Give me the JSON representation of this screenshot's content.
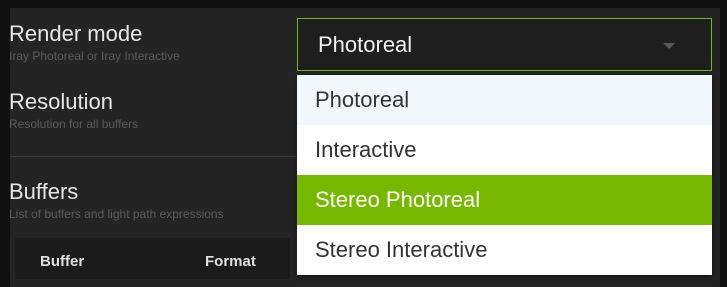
{
  "properties": [
    {
      "label": "Render mode",
      "description": "Iray Photoreal or Iray Interactive"
    },
    {
      "label": "Resolution",
      "description": "Resolution for all buffers"
    },
    {
      "label": "Buffers",
      "description": "List of buffers and light path expressions"
    }
  ],
  "buffers_table": {
    "columns": [
      "Buffer",
      "Format"
    ]
  },
  "render_mode_select": {
    "value": "Photoreal",
    "options": [
      "Photoreal",
      "Interactive",
      "Stereo Photoreal",
      "Stereo Interactive"
    ],
    "highlighted_option": "Stereo Photoreal"
  },
  "colors": {
    "accent": "#76b900",
    "panel": "#242424",
    "menu_bg": "#ffffff",
    "hover_bg": "#f2f7fc"
  },
  "icons": {
    "select_caret": "chevron-down-icon"
  }
}
